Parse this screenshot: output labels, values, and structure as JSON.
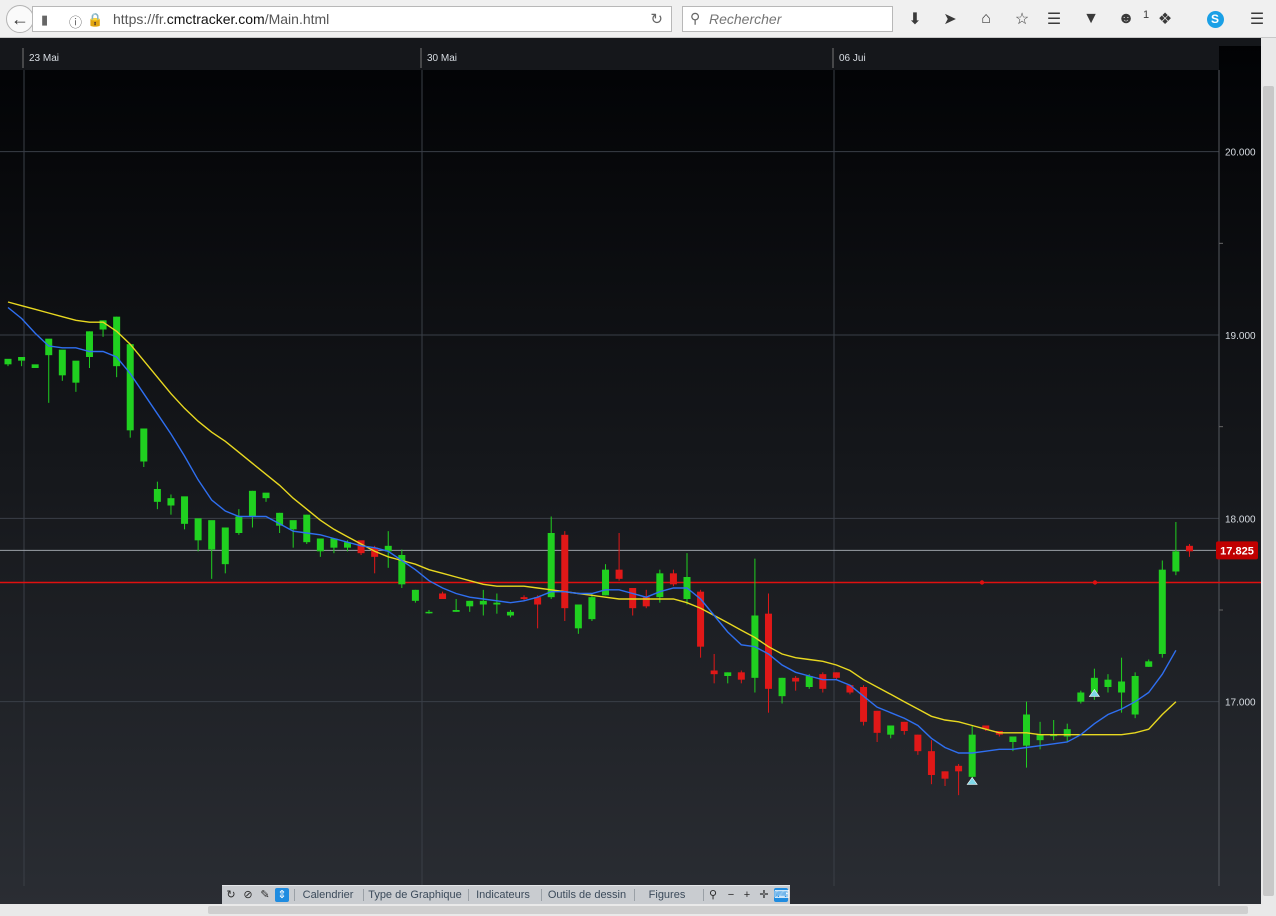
{
  "browser": {
    "url_prefix": "https://fr.",
    "url_domain": "cmctracker.com",
    "url_path": "/Main.html",
    "search_placeholder": "Rechercher",
    "badge_count": "1"
  },
  "chart_toolbar": {
    "items": [
      "Calendrier",
      "Type de Graphique",
      "Indicateurs",
      "Outils de dessin",
      "Figures"
    ]
  },
  "chart_data": {
    "type": "candlestick",
    "x_ticks": [
      "23 Mai",
      "30 Mai",
      "06 Jui"
    ],
    "y_ticks": [
      20.0,
      19.0,
      18.0,
      17.0
    ],
    "y_tick_labels": [
      "20.000",
      "19.000",
      "18.000",
      "17.000"
    ],
    "ylim": [
      16.0,
      20.62
    ],
    "current_price": 17.825,
    "current_price_label": "17.825",
    "reference_level": 17.65,
    "colors": {
      "up": "#20d020",
      "down": "#e01818",
      "ma_fast": "#2f6ff0",
      "ma_slow": "#e8d820",
      "reference": "#e01010",
      "price_tag": "#c00000"
    },
    "candles": [
      [
        18.84,
        18.87,
        18.83,
        18.85
      ],
      [
        18.86,
        18.88,
        18.83,
        18.86
      ],
      [
        18.82,
        18.84,
        18.82,
        18.82
      ],
      [
        18.89,
        18.98,
        18.63,
        18.95
      ],
      [
        18.78,
        18.92,
        18.75,
        18.88
      ],
      [
        18.74,
        18.86,
        18.69,
        18.82
      ],
      [
        18.88,
        19.02,
        18.82,
        19.02
      ],
      [
        19.03,
        19.08,
        18.99,
        19.07
      ],
      [
        18.83,
        19.1,
        18.77,
        19.1
      ],
      [
        18.48,
        18.95,
        18.44,
        18.87
      ],
      [
        18.31,
        18.49,
        18.28,
        18.49
      ],
      [
        18.09,
        18.16,
        18.05,
        18.2
      ],
      [
        18.07,
        18.11,
        18.02,
        18.13
      ],
      [
        17.97,
        18.12,
        17.94,
        18.06
      ],
      [
        17.88,
        18.0,
        17.82,
        17.94
      ],
      [
        17.83,
        17.99,
        17.67,
        17.95
      ],
      [
        17.75,
        17.95,
        17.7,
        17.95
      ],
      [
        17.92,
        18.01,
        17.91,
        18.05
      ],
      [
        18.01,
        18.15,
        17.95,
        18.15
      ],
      [
        18.11,
        18.14,
        18.09,
        18.13
      ],
      [
        17.96,
        18.03,
        17.92,
        18.03
      ],
      [
        17.94,
        17.99,
        17.84,
        17.97
      ],
      [
        17.87,
        18.02,
        17.86,
        18.02
      ],
      [
        17.82,
        17.89,
        17.79,
        17.89
      ],
      [
        17.84,
        17.89,
        17.81,
        17.87
      ],
      [
        17.84,
        17.87,
        17.82,
        17.88
      ],
      [
        17.88,
        17.81,
        17.8,
        17.86
      ],
      [
        17.84,
        17.79,
        17.7,
        17.85
      ],
      [
        17.82,
        17.85,
        17.73,
        17.93
      ],
      [
        17.64,
        17.8,
        17.62,
        17.83
      ],
      [
        17.55,
        17.61,
        17.54,
        17.61
      ],
      [
        17.49,
        17.49,
        17.48,
        17.5
      ],
      [
        17.59,
        17.56,
        17.56,
        17.6
      ],
      [
        17.49,
        17.5,
        17.49,
        17.56
      ],
      [
        17.52,
        17.55,
        17.49,
        17.55
      ],
      [
        17.53,
        17.55,
        17.47,
        17.61
      ],
      [
        17.53,
        17.54,
        17.48,
        17.59
      ],
      [
        17.47,
        17.49,
        17.46,
        17.5
      ],
      [
        17.57,
        17.56,
        17.55,
        17.58
      ],
      [
        17.57,
        17.53,
        17.4,
        17.58
      ],
      [
        17.57,
        17.92,
        17.56,
        18.01
      ],
      [
        17.91,
        17.51,
        17.44,
        17.93
      ],
      [
        17.4,
        17.53,
        17.37,
        17.53
      ],
      [
        17.45,
        17.57,
        17.44,
        17.59
      ],
      [
        17.58,
        17.72,
        17.58,
        17.75
      ],
      [
        17.72,
        17.67,
        17.66,
        17.92
      ],
      [
        17.62,
        17.51,
        17.47,
        17.61
      ],
      [
        17.57,
        17.52,
        17.51,
        17.61
      ],
      [
        17.57,
        17.7,
        17.54,
        17.72
      ],
      [
        17.7,
        17.64,
        17.63,
        17.72
      ],
      [
        17.56,
        17.68,
        17.53,
        17.81
      ],
      [
        17.6,
        17.3,
        17.24,
        17.61
      ],
      [
        17.17,
        17.15,
        17.1,
        17.26
      ],
      [
        17.14,
        17.16,
        17.1,
        17.16
      ],
      [
        17.16,
        17.12,
        17.1,
        17.17
      ],
      [
        17.13,
        17.47,
        17.05,
        17.78
      ],
      [
        17.48,
        17.07,
        16.94,
        17.59
      ],
      [
        17.03,
        17.13,
        16.99,
        17.13
      ],
      [
        17.13,
        17.11,
        17.06,
        17.14
      ],
      [
        17.08,
        17.14,
        17.07,
        17.15
      ],
      [
        17.15,
        17.07,
        17.05,
        17.16
      ],
      [
        17.16,
        17.13,
        17.12,
        17.16
      ],
      [
        17.09,
        17.05,
        17.04,
        17.09
      ],
      [
        17.08,
        16.89,
        16.87,
        17.09
      ],
      [
        16.95,
        16.83,
        16.78,
        16.95
      ],
      [
        16.82,
        16.87,
        16.8,
        16.87
      ],
      [
        16.89,
        16.84,
        16.82,
        16.89
      ],
      [
        16.82,
        16.73,
        16.71,
        16.82
      ],
      [
        16.73,
        16.6,
        16.55,
        16.79
      ],
      [
        16.62,
        16.58,
        16.54,
        16.62
      ],
      [
        16.65,
        16.62,
        16.49,
        16.66
      ],
      [
        16.59,
        16.82,
        16.58,
        16.87
      ],
      [
        16.87,
        16.85,
        16.84,
        16.87
      ],
      [
        16.84,
        16.82,
        16.81,
        16.84
      ],
      [
        16.78,
        16.81,
        16.73,
        16.79
      ],
      [
        16.76,
        16.93,
        16.64,
        17.0
      ],
      [
        16.79,
        16.82,
        16.74,
        16.89
      ],
      [
        16.82,
        16.82,
        16.79,
        16.9
      ],
      [
        16.81,
        16.85,
        16.78,
        16.88
      ],
      [
        17.0,
        17.05,
        16.99,
        17.06
      ],
      [
        17.05,
        17.13,
        17.01,
        17.18
      ],
      [
        17.08,
        17.12,
        17.05,
        17.15
      ],
      [
        17.05,
        17.11,
        16.94,
        17.24
      ],
      [
        16.93,
        17.14,
        16.91,
        17.16
      ],
      [
        17.19,
        17.22,
        17.19,
        17.23
      ],
      [
        17.26,
        17.72,
        17.24,
        17.77
      ],
      [
        17.71,
        17.82,
        17.69,
        17.98
      ],
      [
        17.85,
        17.82,
        17.79,
        17.86
      ]
    ],
    "ma_fast": [
      [
        0,
        19.15
      ],
      [
        1,
        19.09
      ],
      [
        2,
        19.01
      ],
      [
        3,
        18.94
      ],
      [
        4,
        18.93
      ],
      [
        5,
        18.93
      ],
      [
        6,
        18.91
      ],
      [
        7,
        18.91
      ],
      [
        8,
        18.88
      ],
      [
        9,
        18.79
      ],
      [
        10,
        18.68
      ],
      [
        11,
        18.57
      ],
      [
        12,
        18.46
      ],
      [
        13,
        18.34
      ],
      [
        14,
        18.21
      ],
      [
        15,
        18.1
      ],
      [
        16,
        18.04
      ],
      [
        17,
        18.01
      ],
      [
        18,
        18.01
      ],
      [
        19,
        18.01
      ],
      [
        20,
        17.97
      ],
      [
        21,
        17.93
      ],
      [
        22,
        17.92
      ],
      [
        23,
        17.91
      ],
      [
        24,
        17.89
      ],
      [
        25,
        17.87
      ],
      [
        26,
        17.85
      ],
      [
        27,
        17.84
      ],
      [
        28,
        17.82
      ],
      [
        29,
        17.77
      ],
      [
        30,
        17.72
      ],
      [
        31,
        17.66
      ],
      [
        32,
        17.62
      ],
      [
        33,
        17.59
      ],
      [
        34,
        17.57
      ],
      [
        35,
        17.56
      ],
      [
        36,
        17.55
      ],
      [
        37,
        17.54
      ],
      [
        38,
        17.55
      ],
      [
        39,
        17.57
      ],
      [
        40,
        17.6
      ],
      [
        41,
        17.6
      ],
      [
        42,
        17.59
      ],
      [
        43,
        17.59
      ],
      [
        44,
        17.61
      ],
      [
        45,
        17.61
      ],
      [
        46,
        17.59
      ],
      [
        47,
        17.57
      ],
      [
        48,
        17.6
      ],
      [
        49,
        17.62
      ],
      [
        50,
        17.62
      ],
      [
        51,
        17.56
      ],
      [
        52,
        17.47
      ],
      [
        53,
        17.38
      ],
      [
        54,
        17.31
      ],
      [
        55,
        17.3
      ],
      [
        56,
        17.26
      ],
      [
        57,
        17.2
      ],
      [
        58,
        17.16
      ],
      [
        59,
        17.14
      ],
      [
        60,
        17.12
      ],
      [
        61,
        17.12
      ],
      [
        62,
        17.09
      ],
      [
        63,
        17.03
      ],
      [
        64,
        16.97
      ],
      [
        65,
        16.94
      ],
      [
        66,
        16.91
      ],
      [
        67,
        16.87
      ],
      [
        68,
        16.8
      ],
      [
        69,
        16.75
      ],
      [
        70,
        16.72
      ],
      [
        71,
        16.72
      ],
      [
        72,
        16.73
      ],
      [
        73,
        16.74
      ],
      [
        74,
        16.74
      ],
      [
        75,
        16.75
      ],
      [
        76,
        16.76
      ],
      [
        77,
        16.77
      ],
      [
        78,
        16.78
      ],
      [
        79,
        16.82
      ],
      [
        80,
        16.88
      ],
      [
        81,
        16.93
      ],
      [
        82,
        16.96
      ],
      [
        83,
        17.0
      ],
      [
        84,
        17.05
      ],
      [
        85,
        17.15
      ],
      [
        86,
        17.28
      ]
    ],
    "ma_slow": [
      [
        0,
        19.18
      ],
      [
        1,
        19.16
      ],
      [
        2,
        19.14
      ],
      [
        3,
        19.12
      ],
      [
        4,
        19.1
      ],
      [
        5,
        19.08
      ],
      [
        6,
        19.07
      ],
      [
        7,
        19.07
      ],
      [
        8,
        19.02
      ],
      [
        9,
        18.95
      ],
      [
        10,
        18.86
      ],
      [
        11,
        18.77
      ],
      [
        12,
        18.68
      ],
      [
        13,
        18.6
      ],
      [
        14,
        18.53
      ],
      [
        15,
        18.47
      ],
      [
        16,
        18.42
      ],
      [
        17,
        18.36
      ],
      [
        18,
        18.3
      ],
      [
        19,
        18.24
      ],
      [
        20,
        18.18
      ],
      [
        21,
        18.11
      ],
      [
        22,
        18.05
      ],
      [
        23,
        17.99
      ],
      [
        24,
        17.94
      ],
      [
        25,
        17.9
      ],
      [
        26,
        17.86
      ],
      [
        27,
        17.82
      ],
      [
        28,
        17.79
      ],
      [
        29,
        17.77
      ],
      [
        30,
        17.75
      ],
      [
        31,
        17.72
      ],
      [
        32,
        17.7
      ],
      [
        33,
        17.68
      ],
      [
        34,
        17.66
      ],
      [
        35,
        17.64
      ],
      [
        36,
        17.63
      ],
      [
        37,
        17.63
      ],
      [
        38,
        17.63
      ],
      [
        39,
        17.62
      ],
      [
        40,
        17.61
      ],
      [
        41,
        17.6
      ],
      [
        42,
        17.59
      ],
      [
        43,
        17.58
      ],
      [
        44,
        17.57
      ],
      [
        45,
        17.56
      ],
      [
        46,
        17.56
      ],
      [
        47,
        17.56
      ],
      [
        48,
        17.56
      ],
      [
        49,
        17.56
      ],
      [
        50,
        17.54
      ],
      [
        51,
        17.51
      ],
      [
        52,
        17.47
      ],
      [
        53,
        17.43
      ],
      [
        54,
        17.39
      ],
      [
        55,
        17.35
      ],
      [
        56,
        17.3
      ],
      [
        57,
        17.26
      ],
      [
        58,
        17.24
      ],
      [
        59,
        17.23
      ],
      [
        60,
        17.22
      ],
      [
        61,
        17.2
      ],
      [
        62,
        17.17
      ],
      [
        63,
        17.12
      ],
      [
        64,
        17.08
      ],
      [
        65,
        17.04
      ],
      [
        66,
        17.0
      ],
      [
        67,
        16.96
      ],
      [
        68,
        16.92
      ],
      [
        69,
        16.9
      ],
      [
        70,
        16.89
      ],
      [
        71,
        16.87
      ],
      [
        72,
        16.85
      ],
      [
        73,
        16.83
      ],
      [
        74,
        16.83
      ],
      [
        75,
        16.83
      ],
      [
        76,
        16.82
      ],
      [
        77,
        16.82
      ],
      [
        78,
        16.82
      ],
      [
        79,
        16.82
      ],
      [
        80,
        16.82
      ],
      [
        81,
        16.82
      ],
      [
        82,
        16.82
      ],
      [
        83,
        16.83
      ],
      [
        84,
        16.85
      ],
      [
        85,
        16.93
      ],
      [
        86,
        17.0
      ]
    ]
  }
}
